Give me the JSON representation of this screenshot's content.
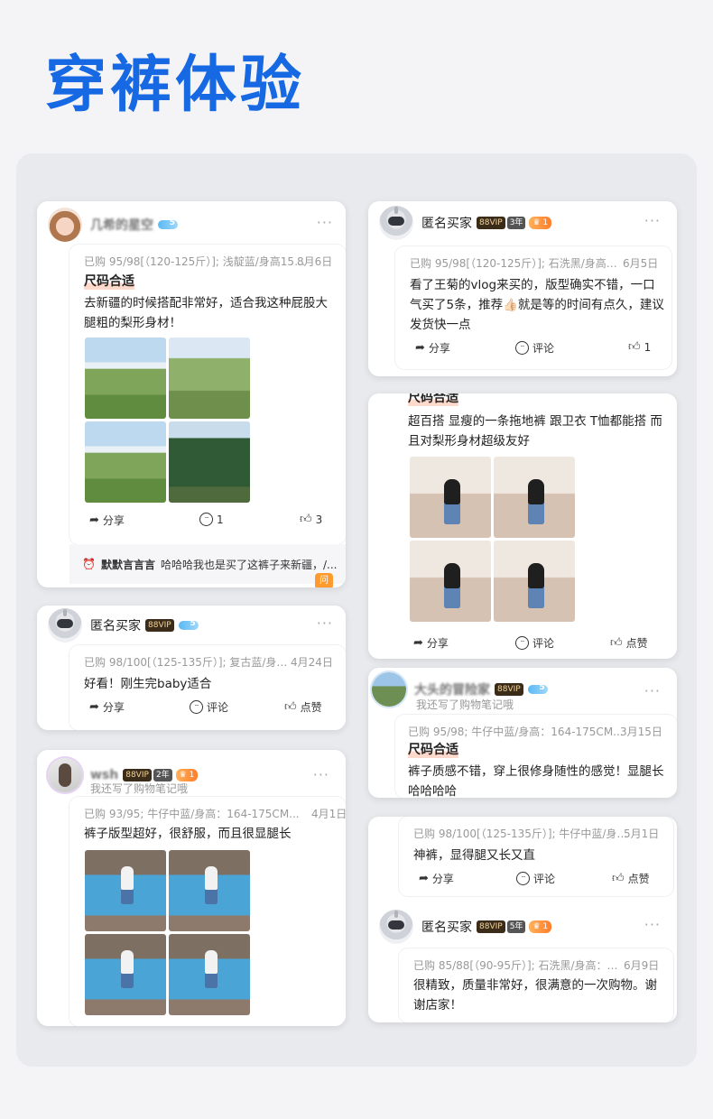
{
  "page_title": "穿裤体验",
  "reviews": {
    "r1": {
      "user": "几希的星空",
      "purchase": "已购 95/98[（120-125斤）]; 浅靛蓝/身高15…",
      "date": "8月6日",
      "tag": "尺码合适",
      "text": "去新疆的时候搭配非常好，适合我这种屁股大腿粗的梨形身材！",
      "share": "分享",
      "comment": "1",
      "like": "3",
      "reply_user": "默默言言言",
      "reply_text": "哈哈哈我也是买了这裤子来新疆，/...",
      "ask": "问"
    },
    "r2": {
      "user": "匿名买家",
      "vip": "88VIP",
      "purchase": "已购 98/100[（125-135斤）]; 复古蓝/身…",
      "date": "4月24日",
      "text": "好看！刚生完baby适合",
      "share": "分享",
      "comment": "评论",
      "like": "点赞"
    },
    "r3": {
      "user": "wsh",
      "vip": "88VIP",
      "years": "2年",
      "crown": "1",
      "note": "我还写了购物笔记哦",
      "purchase": "已购 93/95; 牛仔中蓝/身高：164-175CM...",
      "date": "4月1日",
      "text": "裤子版型超好，很舒服，而且很显腿长"
    },
    "r4": {
      "user": "匿名买家",
      "vip": "88VIP",
      "years": "3年",
      "crown": "1",
      "purchase": "已购 95/98[（120-125斤）]; 石洗黑/身高…",
      "date": "6月5日",
      "text": "看了王菊的vlog来买的，版型确实不错，一口气买了5条，推荐👍🏻就是等的时间有点久，建议发货快一点",
      "share": "分享",
      "comment": "评论",
      "like": "1"
    },
    "r5": {
      "tag": "尺码合适",
      "text": "超百搭 显瘦的一条拖地裤 跟卫衣 T恤都能搭 而且对梨形身材超级友好",
      "share": "分享",
      "comment": "评论",
      "like": "点赞"
    },
    "r6": {
      "user": "大头的冒险家",
      "vip": "88VIP",
      "note": "我还写了购物笔记哦",
      "purchase": "已购 95/98; 牛仔中蓝/身高：164-175CM...",
      "date": "3月15日",
      "tag": "尺码合适",
      "text": "裤子质感不错，穿上很修身随性的感觉！显腿长哈哈哈哈"
    },
    "r7": {
      "purchase": "已购 98/100[（125-135斤）]; 牛仔中蓝/身…",
      "date": "5月1日",
      "text": "神裤，显得腿又长又直",
      "share": "分享",
      "comment": "评论",
      "like": "点赞"
    },
    "r8": {
      "user": "匿名买家",
      "vip": "88VIP",
      "years": "5年",
      "crown": "1",
      "purchase": "已购 85/88[（90-95斤）]; 石洗黑/身高：…",
      "date": "6月9日",
      "text": "很精致，质量非常好，很满意的一次购物。谢谢店家！"
    }
  },
  "more_icon": "···",
  "colors": {
    "title": "#1668e3",
    "tag_highlight": "#ffd9cc",
    "vip_bg": "#3b2c1a",
    "crown": "#ff8a2a"
  }
}
